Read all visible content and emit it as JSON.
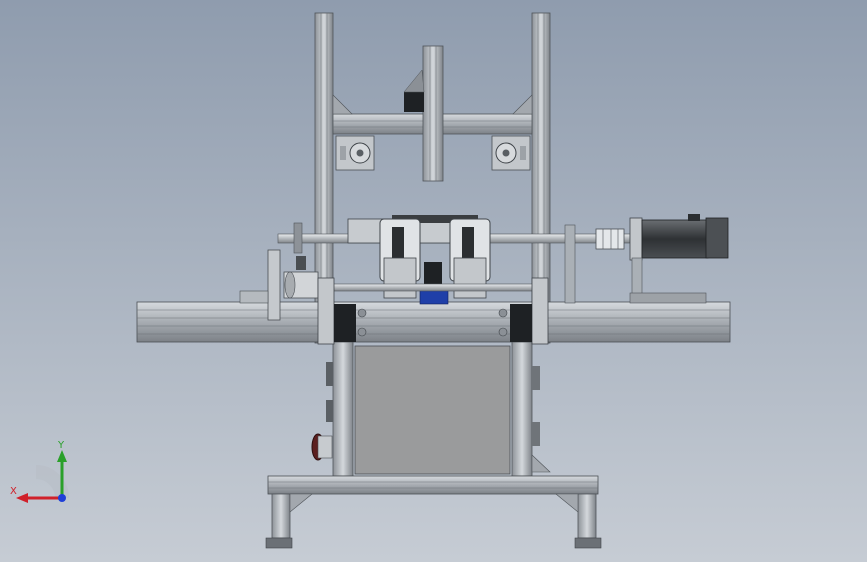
{
  "viewport": {
    "background_top": "#8f9cae",
    "background_bottom": "#c6ccd4"
  },
  "model": {
    "frame_color": "#b9bec4",
    "frame_dark": "#5b6066",
    "panel_color": "#9b9c9d",
    "motor_color": "#3a3d40",
    "accent_blue": "#1f3fa8"
  },
  "triad": {
    "x_label": "X",
    "y_label": "Y",
    "x_color": "#d0202a",
    "y_color": "#2aa02a",
    "z_color": "#1f3fd8"
  }
}
